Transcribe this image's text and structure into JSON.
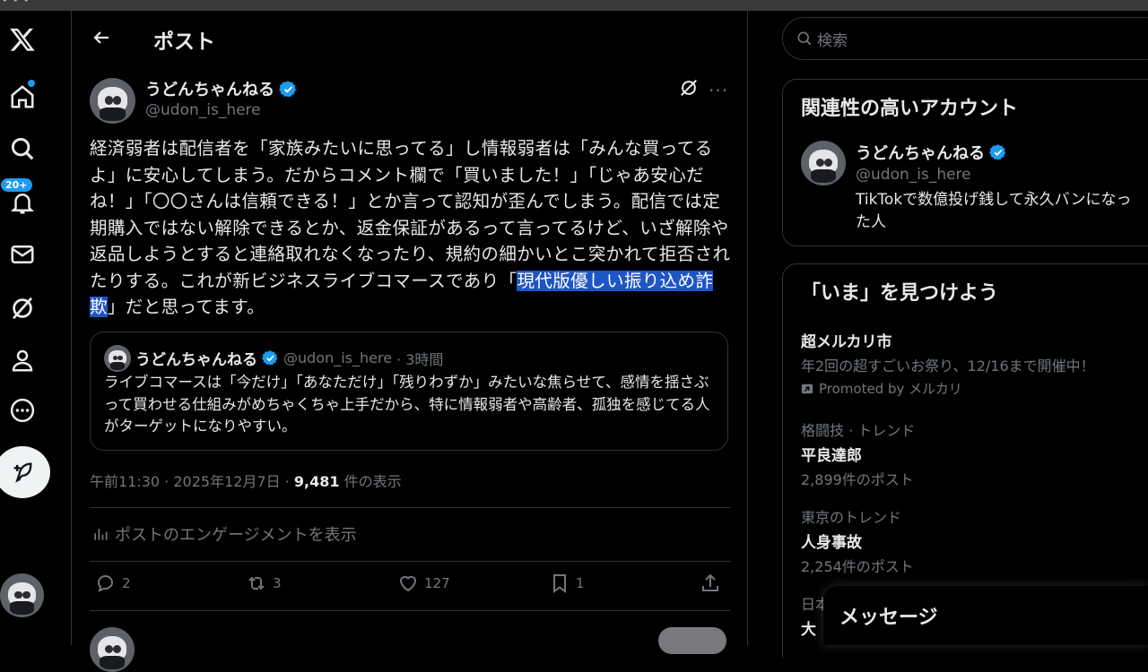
{
  "header": {
    "title": "ポスト"
  },
  "nav": {
    "notifications_badge": "20+",
    "items": [
      "x-logo",
      "home",
      "explore",
      "notifications",
      "messages",
      "grok",
      "profile",
      "more"
    ]
  },
  "post": {
    "author_name": "うどんちゃんねる",
    "author_handle": "@udon_is_here",
    "text_before": "経済弱者は配信者を「家族みたいに思ってる」し情報弱者は「みんな買ってるよ」に安心してしまう。だからコメント欄で「買いました！」「じゃあ安心だね！」「〇〇さんは信頼できる！」とか言って認知が歪んでしまう。配信では定期購入ではない解除できるとか、返金保証があるって言ってるけど、いざ解除や返品しようとすると連絡取れなくなったり、規約の細かいとこ突かれて拒否されたりする。これが新ビジネスライブコマースであり「",
    "text_highlight": "現代版優しい振り込め詐欺",
    "text_after": "」だと思ってます。",
    "quote": {
      "author_name": "うどんちゃんねる",
      "author_handle": "@udon_is_here",
      "time": "· 3時間",
      "text": "ライブコマースは「今だけ」「あなただけ」「残りわずか」みたいな焦らせて、感情を揺さぶって買わせる仕組みがめちゃくちゃ上手だから、特に情報弱者や高齢者、孤独を感じてる人がターゲットになりやすい。"
    },
    "timestamp": "午前11:30 · 2025年12月7日 · ",
    "views": "9,481",
    "views_label": " 件の表示",
    "engagement_link": "ポストのエンゲージメントを表示",
    "actions": {
      "replies": "2",
      "reposts": "3",
      "likes": "127",
      "bookmarks": "1"
    }
  },
  "search": {
    "placeholder": "検索"
  },
  "related": {
    "title": "関連性の高いアカウント",
    "name": "うどんちゃんねる",
    "handle": "@udon_is_here",
    "bio_line1": "TikTokで数億投げ銭して永久バンになっ",
    "bio_line2": "た人"
  },
  "trends": {
    "title": "「いま」を見つけよう",
    "items": [
      {
        "category": "",
        "name": "超メルカリ市",
        "sub": "年2回の超すごいお祭り、12/16まで開催中！",
        "promo": "Promoted by メルカリ"
      },
      {
        "category": "格闘技 · トレンド",
        "name": "平良達郎",
        "sub": "2,899件のポスト"
      },
      {
        "category": "東京のトレンド",
        "name": "人身事故",
        "sub": "2,254件のポスト"
      },
      {
        "category": "日本",
        "name": "大"
      }
    ]
  },
  "messages": {
    "title": "メッセージ"
  },
  "colors": {
    "accent": "#1d9bf0",
    "highlight": "#1f55c4",
    "border": "#2f3336",
    "muted": "#71767b"
  }
}
